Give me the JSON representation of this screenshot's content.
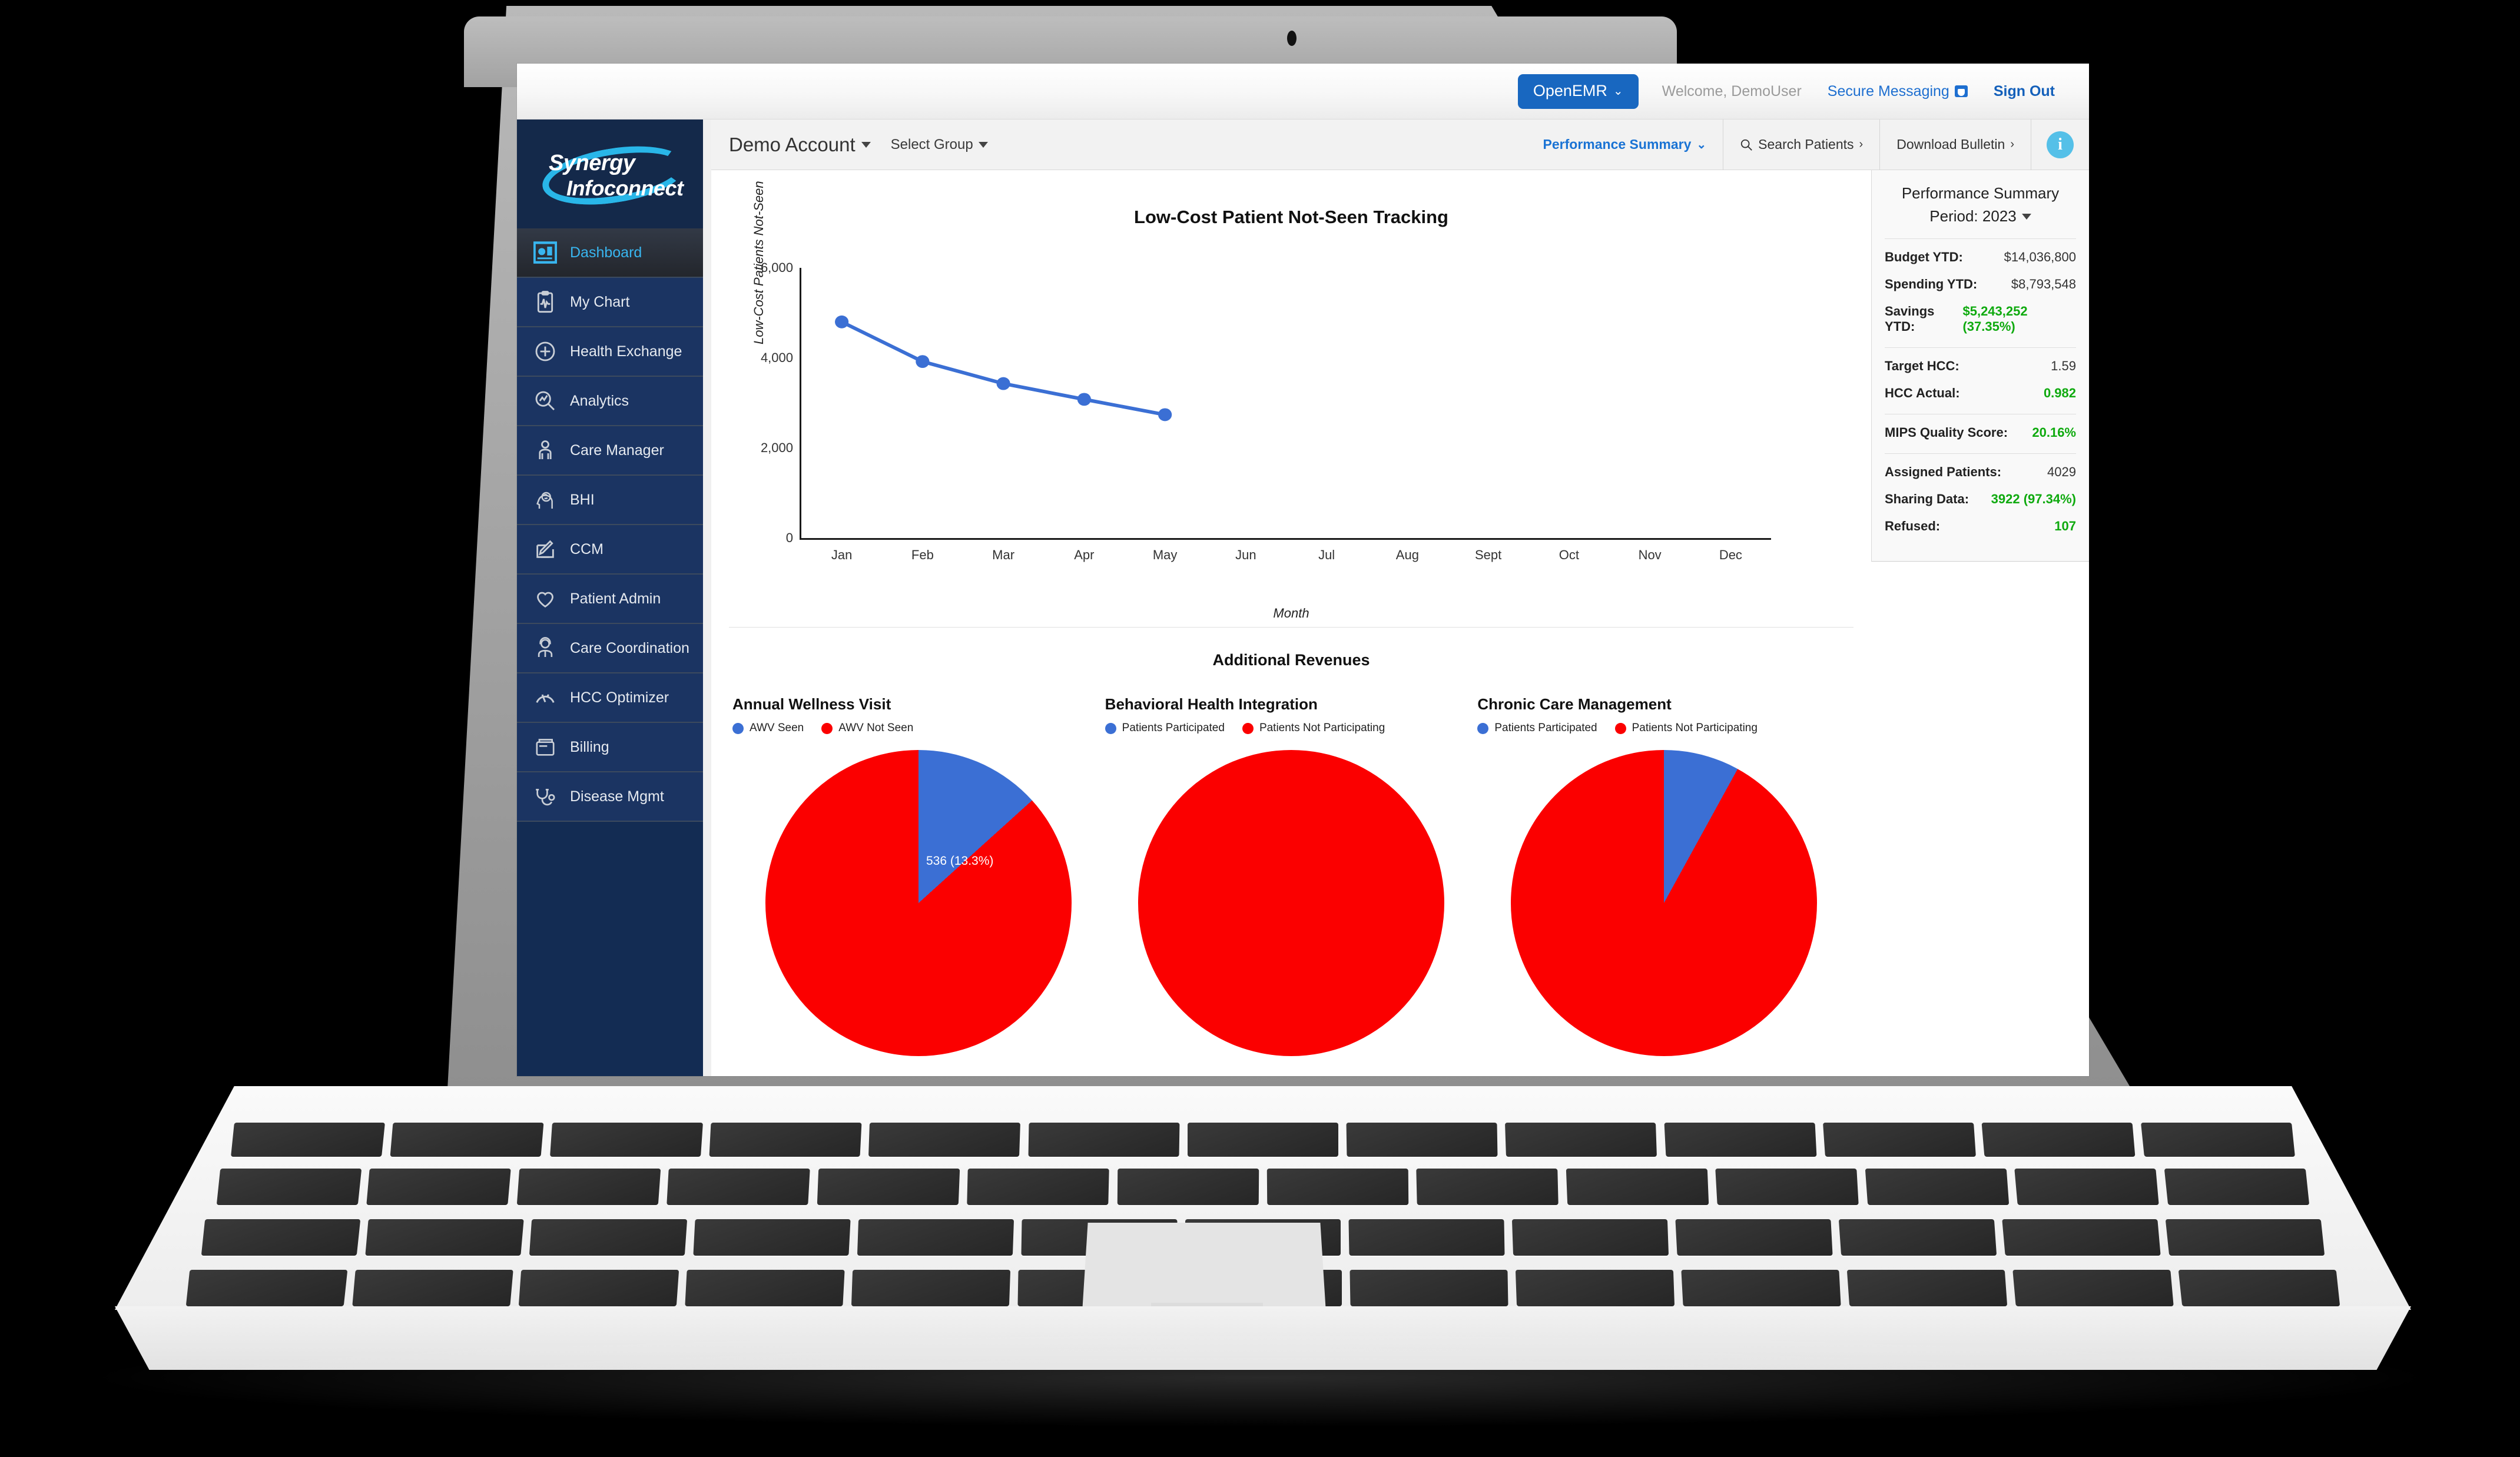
{
  "topbar": {
    "openemr_label": "OpenEMR",
    "openemr_caret": "⌄",
    "welcome": "Welcome, DemoUser",
    "secure_messaging": "Secure Messaging",
    "sign_out": "Sign Out"
  },
  "sidebar": {
    "logo_line1": "Synergy",
    "logo_line2": "Infoconnect",
    "items": [
      {
        "label": "Dashboard",
        "icon": "dashboard-icon",
        "active": true
      },
      {
        "label": "My Chart",
        "icon": "clipboard-chart-icon",
        "active": false
      },
      {
        "label": "Health Exchange",
        "icon": "plus-circle-icon",
        "active": false
      },
      {
        "label": "Analytics",
        "icon": "magnifier-chart-icon",
        "active": false
      },
      {
        "label": "Care Manager",
        "icon": "person-icon",
        "active": false
      },
      {
        "label": "BHI",
        "icon": "brain-head-icon",
        "active": false
      },
      {
        "label": "CCM",
        "icon": "pencil-square-icon",
        "active": false
      },
      {
        "label": "Patient Admin",
        "icon": "heart-icon",
        "active": false
      },
      {
        "label": "Care Coordination",
        "icon": "headset-person-icon",
        "active": false
      },
      {
        "label": "HCC Optimizer",
        "icon": "gauge-icon",
        "active": false
      },
      {
        "label": "Billing",
        "icon": "wallet-icon",
        "active": false
      },
      {
        "label": "Disease Mgmt",
        "icon": "stethoscope-icon",
        "active": false
      }
    ]
  },
  "toolbar": {
    "account": "Demo Account",
    "select_group": "Select Group",
    "performance_summary": "Performance Summary",
    "performance_summary_caret": "⌄",
    "search_patients": "Search Patients",
    "search_icon": "search-icon",
    "download_bulletin": "Download Bulletin",
    "chevron": "›",
    "info_glyph": "i"
  },
  "summary": {
    "title": "Performance Summary",
    "period_label": "Period: 2023",
    "rows_group1": [
      {
        "key": "Budget YTD:",
        "value": "$14,036,800",
        "green": false
      },
      {
        "key": "Spending YTD:",
        "value": "$8,793,548",
        "green": false
      },
      {
        "key": "Savings YTD:",
        "value": "$5,243,252 (37.35%)",
        "green": true
      }
    ],
    "rows_group2": [
      {
        "key": "Target HCC:",
        "value": "1.59",
        "green": false
      },
      {
        "key": "HCC Actual:",
        "value": "0.982",
        "green": true
      }
    ],
    "rows_group3": [
      {
        "key": "MIPS Quality Score:",
        "value": "20.16%",
        "green": true
      }
    ],
    "rows_group4": [
      {
        "key": "Assigned Patients:",
        "value": "4029",
        "green": false
      },
      {
        "key": "Sharing Data:",
        "value": "3922 (97.34%)",
        "green": true
      },
      {
        "key": "Refused:",
        "value": "107",
        "green": true
      }
    ]
  },
  "additional_revenues": {
    "heading": "Additional Revenues",
    "panels": [
      {
        "title": "Annual Wellness Visit",
        "legend": [
          "AWV Seen",
          "AWV Not Seen"
        ],
        "slice_label": "536 (13.3%)"
      },
      {
        "title": "Behavioral Health Integration",
        "legend": [
          "Patients Participated",
          "Patients Not Participating"
        ],
        "slice_label": ""
      },
      {
        "title": "Chronic Care Management",
        "legend": [
          "Patients Participated",
          "Patients Not Participating"
        ],
        "slice_label": ""
      }
    ]
  },
  "colors": {
    "accent_blue": "#1a73d4",
    "brand_navy": "#14294a",
    "brand_cyan": "#29b6e8",
    "series_blue": "#3b6fd4",
    "series_red": "#fb0000",
    "positive_green": "#0faa0f"
  },
  "chart_data": {
    "type": "line",
    "title": "Low-Cost Patient Not-Seen Tracking",
    "xlabel": "Month",
    "ylabel": "Low-Cost Patients Not-Seen",
    "categories": [
      "Jan",
      "Feb",
      "Mar",
      "Apr",
      "May",
      "Jun",
      "Jul",
      "Aug",
      "Sept",
      "Oct",
      "Nov",
      "Dec"
    ],
    "yticks": [
      0,
      2000,
      4000,
      6000
    ],
    "ytick_labels": [
      "0",
      "2,000",
      "4,000",
      "6,000"
    ],
    "ylim": [
      0,
      6000
    ],
    "grid": false,
    "legend": "none",
    "series": [
      {
        "name": "Low-Cost Patients Not-Seen",
        "color": "#3b6fd4",
        "values": [
          4800,
          3920,
          3430,
          3080,
          2740,
          null,
          null,
          null,
          null,
          null,
          null,
          null
        ]
      }
    ]
  },
  "pie_data": [
    {
      "type": "pie",
      "title": "Annual Wellness Visit",
      "labels": [
        "AWV Seen",
        "AWV Not Seen"
      ],
      "values": [
        536,
        3493
      ],
      "percents": [
        13.3,
        86.7
      ],
      "colors": [
        "#3b6fd4",
        "#fb0000"
      ],
      "data_labels": [
        "536 (13.3%)",
        ""
      ]
    },
    {
      "type": "pie",
      "title": "Behavioral Health Integration",
      "labels": [
        "Patients Participated",
        "Patients Not Participating"
      ],
      "values": [
        0,
        4029
      ],
      "percents": [
        0,
        100
      ],
      "colors": [
        "#3b6fd4",
        "#fb0000"
      ],
      "data_labels": [
        "",
        ""
      ]
    },
    {
      "type": "pie",
      "title": "Chronic Care Management",
      "labels": [
        "Patients Participated",
        "Patients Not Participating"
      ],
      "values": [
        322,
        3707
      ],
      "percents": [
        8.0,
        92.0
      ],
      "colors": [
        "#3b6fd4",
        "#fb0000"
      ],
      "data_labels": [
        "",
        ""
      ]
    }
  ]
}
